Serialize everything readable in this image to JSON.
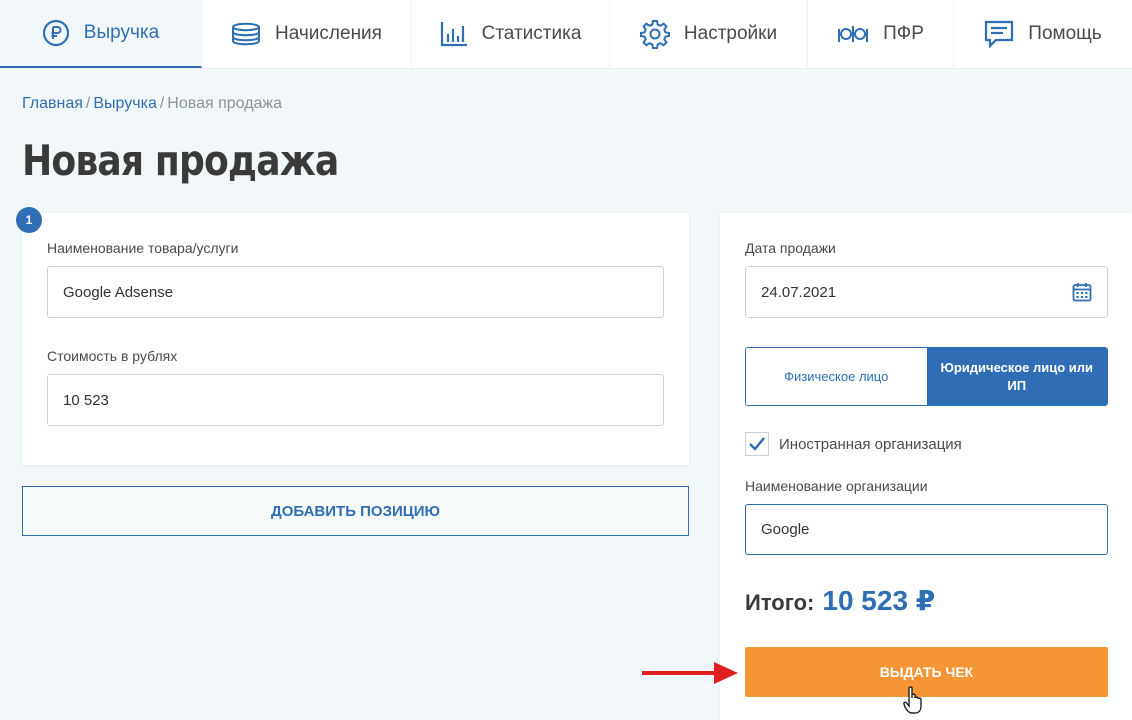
{
  "nav": {
    "tabs": [
      {
        "label": "Выручка",
        "icon": "ruble-icon",
        "active": true
      },
      {
        "label": "Начисления",
        "icon": "coins-stack-icon",
        "active": false
      },
      {
        "label": "Статистика",
        "icon": "bar-chart-icon",
        "active": false
      },
      {
        "label": "Настройки",
        "icon": "gear-icon",
        "active": false
      },
      {
        "label": "ПФР",
        "icon": "pfr-logo-icon",
        "active": false
      },
      {
        "label": "Помощь",
        "icon": "message-icon",
        "active": false
      }
    ]
  },
  "breadcrumb": {
    "home": "Главная",
    "section": "Выручка",
    "current": "Новая продажа",
    "separator": "/"
  },
  "page": {
    "title": "Новая продажа",
    "step": "1"
  },
  "item": {
    "name_label": "Наименование товара/услуги",
    "name_value": "Google Adsense",
    "price_label": "Стоимость в рублях",
    "price_value": "10 523"
  },
  "add_button": "ДОБАВИТЬ ПОЗИЦИЮ",
  "sale": {
    "date_label": "Дата продажи",
    "date_value": "24.07.2021",
    "buyer_individual": "Физическое лицо",
    "buyer_legal": "Юридическое лицо или ИП",
    "buyer_selected": "legal",
    "foreign_label": "Иностранная организация",
    "foreign_checked": true,
    "org_label": "Наименование организации",
    "org_value": "Google",
    "total_label": "Итого:",
    "total_value": "10 523 ₽",
    "issue_button": "ВЫДАТЬ ЧЕК"
  },
  "colors": {
    "accent": "#2f6eb5",
    "action": "#f59535",
    "arrow": "#e02020"
  }
}
